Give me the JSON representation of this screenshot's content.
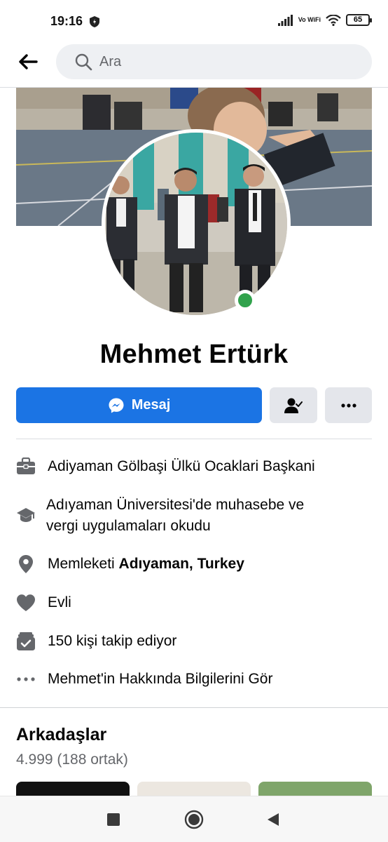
{
  "status": {
    "time": "19:16",
    "network": "Vo WiFi",
    "battery": "65"
  },
  "search": {
    "placeholder": "Ara"
  },
  "profile": {
    "name": "Mehmet Ertürk",
    "online": true,
    "actions": {
      "message_label": "Mesaj"
    }
  },
  "details": [
    {
      "icon": "briefcase-icon",
      "text": "Adiyaman Gölbaşi Ülkü Ocaklari Başkani"
    },
    {
      "icon": "graduation-cap-icon",
      "text_line1": "Adıyaman Üniversitesi'de muhasebe ve",
      "text_line2": "vergi uygulamaları okudu"
    },
    {
      "icon": "location-pin-icon",
      "prefix": "Memleketi ",
      "bold": "Adıyaman, Turkey"
    },
    {
      "icon": "heart-icon",
      "text": "Evli"
    },
    {
      "icon": "follow-check-icon",
      "text": "150 kişi takip ediyor"
    },
    {
      "icon": "ellipsis-icon",
      "text": "Mehmet'in Hakkında Bilgilerini Gör"
    }
  ],
  "friends": {
    "title": "Arkadaşlar",
    "count": "4.999 (188 ortak)"
  },
  "colors": {
    "accent": "#1b74e4",
    "online": "#31a24c",
    "secondary_button": "#e4e6eb"
  }
}
